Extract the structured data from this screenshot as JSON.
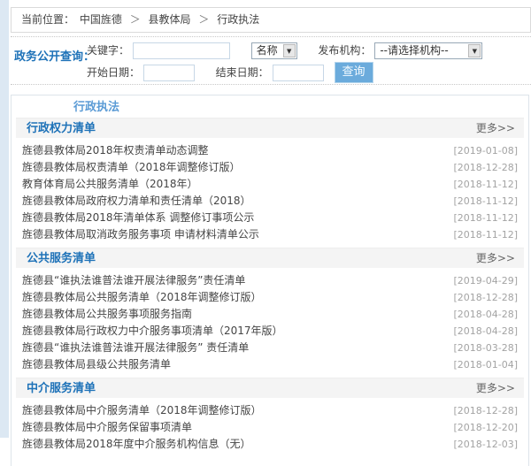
{
  "breadcrumb": {
    "label": "当前位置：",
    "separator": "＞",
    "items": [
      "中国旌德",
      "县教体局",
      "行政执法"
    ]
  },
  "search": {
    "title": "政务公开查询：",
    "keyword_label": "关键字：",
    "keyword_value": "",
    "type_select_value": "名称",
    "publisher_label": "发布机构：",
    "publisher_select_value": "--请选择机构--",
    "start_date_label": "开始日期：",
    "start_date_value": "",
    "end_date_label": "结束日期：",
    "end_date_value": "",
    "submit_label": "查询"
  },
  "tab": {
    "label": "行政执法"
  },
  "sections": [
    {
      "title": "行政权力清单",
      "more": "更多>>",
      "items": [
        {
          "title": "旌德县教体局2018年权责清单动态调整",
          "date": "[2019-01-08]"
        },
        {
          "title": "旌德县教体局权责清单（2018年调整修订版）",
          "date": "[2018-12-28]"
        },
        {
          "title": "教育体育局公共服务清单（2018年）",
          "date": "[2018-11-12]"
        },
        {
          "title": "旌德县教体局政府权力清单和责任清单（2018）",
          "date": "[2018-11-12]"
        },
        {
          "title": "旌德县教体局2018年清单体系 调整修订事项公示",
          "date": "[2018-11-12]"
        },
        {
          "title": "旌德县教体局取消政务服务事项 申请材料清单公示",
          "date": "[2018-11-12]"
        }
      ]
    },
    {
      "title": "公共服务清单",
      "more": "更多>>",
      "items": [
        {
          "title": "旌德县“谁执法谁普法谁开展法律服务”责任清单",
          "date": "[2019-04-29]"
        },
        {
          "title": "旌德县教体局公共服务清单（2018年调整修订版）",
          "date": "[2018-12-28]"
        },
        {
          "title": "旌德县教体局公共服务事项服务指南",
          "date": "[2018-04-28]"
        },
        {
          "title": "旌德县教体局行政权力中介服务事项清单（2017年版）",
          "date": "[2018-04-28]"
        },
        {
          "title": "旌德县“谁执法谁普法谁开展法律服务” 责任清单",
          "date": "[2018-03-28]"
        },
        {
          "title": "旌德县教体局县级公共服务清单",
          "date": "[2018-01-04]"
        }
      ]
    },
    {
      "title": "中介服务清单",
      "more": "更多>>",
      "items": [
        {
          "title": "旌德县教体局中介服务清单（2018年调整修订版）",
          "date": "[2018-12-28]"
        },
        {
          "title": "旌德县教体局中介服务保留事项清单",
          "date": "[2018-12-20]"
        },
        {
          "title": "旌德县教体局2018年度中介服务机构信息（无）",
          "date": "[2018-12-03]"
        }
      ]
    }
  ],
  "colors": {
    "accent_blue": "#1e72b8",
    "tab_blue": "#5b9bd5",
    "button_blue": "#6babdc",
    "left_strip_blue": "#dce8f3",
    "section_bar_gray": "#f4f4f4",
    "date_gray": "#a3a3a3"
  }
}
